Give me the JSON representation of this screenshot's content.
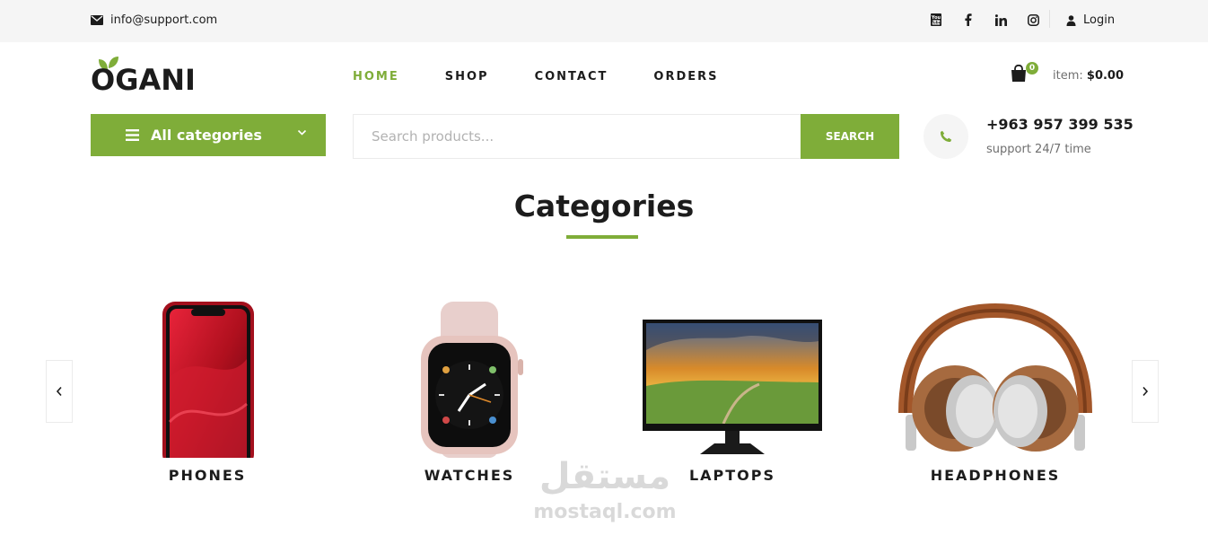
{
  "topbar": {
    "email": "info@support.com",
    "login_label": "Login",
    "social_icons": [
      "youtube-icon",
      "facebook-icon",
      "linkedin-icon",
      "instagram-icon"
    ]
  },
  "header": {
    "logo_text": "OGANI",
    "nav": [
      {
        "label": "HOME",
        "active": true
      },
      {
        "label": "SHOP",
        "active": false
      },
      {
        "label": "CONTACT",
        "active": false
      },
      {
        "label": "ORDERS",
        "active": false
      }
    ],
    "cart": {
      "count": "0",
      "item_label": "item:",
      "total": "$0.00"
    }
  },
  "hero": {
    "categories_label": "All categories",
    "search": {
      "placeholder": "Search products...",
      "button_label": "SEARCH"
    },
    "phone": {
      "number": "+963 957 399 535",
      "subtitle": "support 24/7 time"
    }
  },
  "categories_section": {
    "title": "Categories",
    "items": [
      {
        "name": "PHONES",
        "icon": "phone-image"
      },
      {
        "name": "WATCHES",
        "icon": "watch-image"
      },
      {
        "name": "LAPTOPS",
        "icon": "monitor-image"
      },
      {
        "name": "HEADPHONES",
        "icon": "headphones-image"
      }
    ]
  },
  "watermark": {
    "arabic": "مستقل",
    "latin": "mostaql.com"
  },
  "colors": {
    "accent": "#7fad39",
    "text": "#1c1c1c",
    "muted": "#6f6f6f",
    "topbar_bg": "#f5f5f5"
  }
}
